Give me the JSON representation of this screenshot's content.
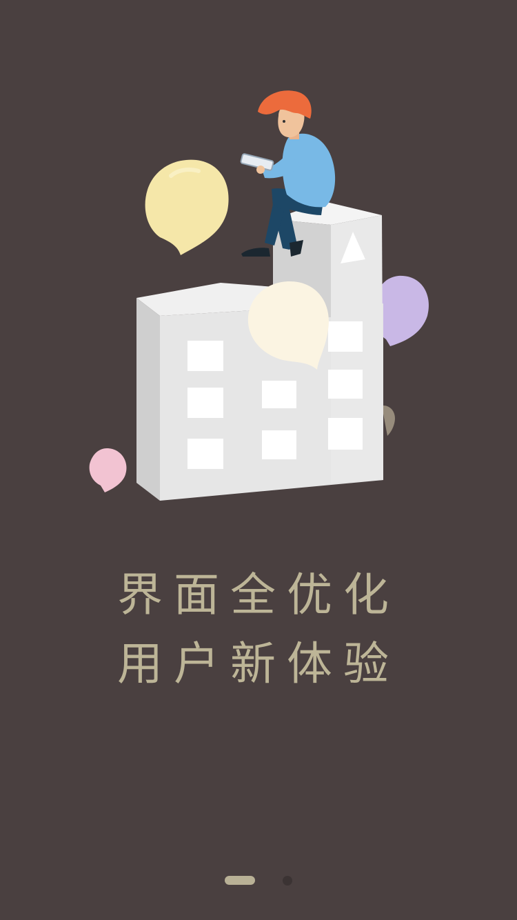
{
  "onboarding": {
    "illustration": {
      "description_icon": "person-on-building-with-balloons-illustration",
      "balloon_colors": [
        "#f5e7a9",
        "#fbf4e2",
        "#c9b8e6",
        "#f2c3d2",
        "#978c7c"
      ],
      "shirt_color": "#78b9e6",
      "hair_color": "#ec6b3c"
    },
    "headline": {
      "line1": "界面全优化",
      "line2": "用户新体验"
    },
    "pager": {
      "current_page": 1,
      "total_pages": 2
    },
    "colors": {
      "background": "#4a4040",
      "text": "#bdb597",
      "dot_active": "#b9b196",
      "dot_inactive": "#3b3333"
    }
  }
}
